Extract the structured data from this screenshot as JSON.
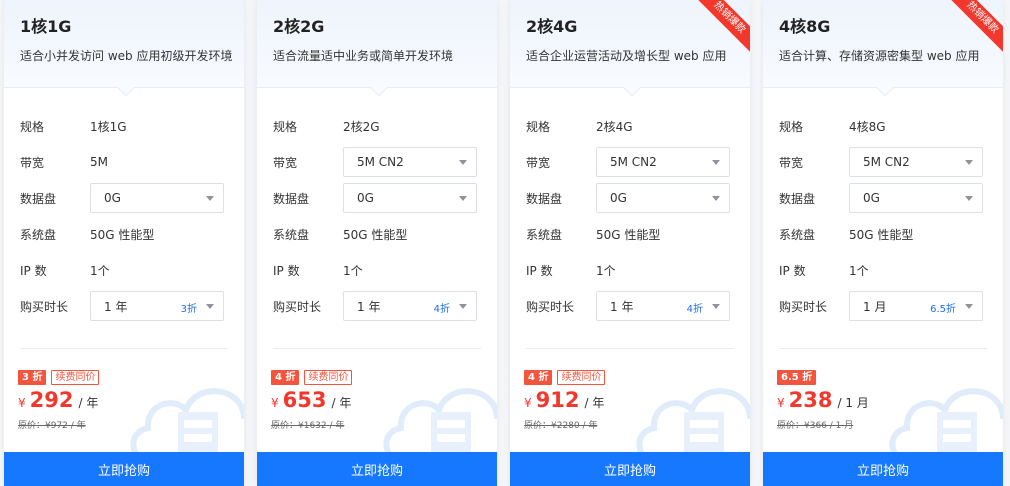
{
  "colors": {
    "accent": "#1677ff",
    "discount": "#f2382c",
    "discount_text": "#1e6fe5"
  },
  "labels": {
    "spec": "规格",
    "bandwidth": "带宽",
    "data_disk": "数据盘",
    "system_disk": "系统盘",
    "ip": "IP 数",
    "duration": "购买时长",
    "renew_badge": "续费同价",
    "currency": "¥",
    "buy": "立即抢购",
    "hot_ribbon": "热销爆款"
  },
  "plans": [
    {
      "name": "1核1G",
      "desc": "适合小并发访问 web 应用初级开发环境",
      "hot": false,
      "spec": "1核1G",
      "bandwidth": "5M",
      "bandwidth_select": false,
      "data_disk": "0G",
      "system_disk": "50G 性能型",
      "ip": "1个",
      "duration": "1 年",
      "duration_discount": "3折",
      "discount_badge": "3 折",
      "renew_same": true,
      "price": "292",
      "price_unit": "/ 年",
      "original": "原价：¥972 / 年"
    },
    {
      "name": "2核2G",
      "desc": "适合流量适中业务或简单开发环境",
      "hot": false,
      "spec": "2核2G",
      "bandwidth": "5M CN2",
      "bandwidth_select": true,
      "data_disk": "0G",
      "system_disk": "50G 性能型",
      "ip": "1个",
      "duration": "1 年",
      "duration_discount": "4折",
      "discount_badge": "4 折",
      "renew_same": true,
      "price": "653",
      "price_unit": "/ 年",
      "original": "原价：¥1632 / 年"
    },
    {
      "name": "2核4G",
      "desc": "适合企业运营活动及增长型 web 应用",
      "hot": true,
      "spec": "2核4G",
      "bandwidth": "5M CN2",
      "bandwidth_select": true,
      "data_disk": "0G",
      "system_disk": "50G 性能型",
      "ip": "1个",
      "duration": "1 年",
      "duration_discount": "4折",
      "discount_badge": "4 折",
      "renew_same": true,
      "price": "912",
      "price_unit": "/ 年",
      "original": "原价：¥2280 / 年"
    },
    {
      "name": "4核8G",
      "desc": "适合计算、存储资源密集型 web 应用",
      "hot": true,
      "spec": "4核8G",
      "bandwidth": "5M CN2",
      "bandwidth_select": true,
      "data_disk": "0G",
      "system_disk": "50G 性能型",
      "ip": "1个",
      "duration": "1 月",
      "duration_discount": "6.5折",
      "discount_badge": "6.5 折",
      "renew_same": false,
      "price": "238",
      "price_unit": "/ 1 月",
      "original": "原价：¥366 / 1 月"
    }
  ]
}
